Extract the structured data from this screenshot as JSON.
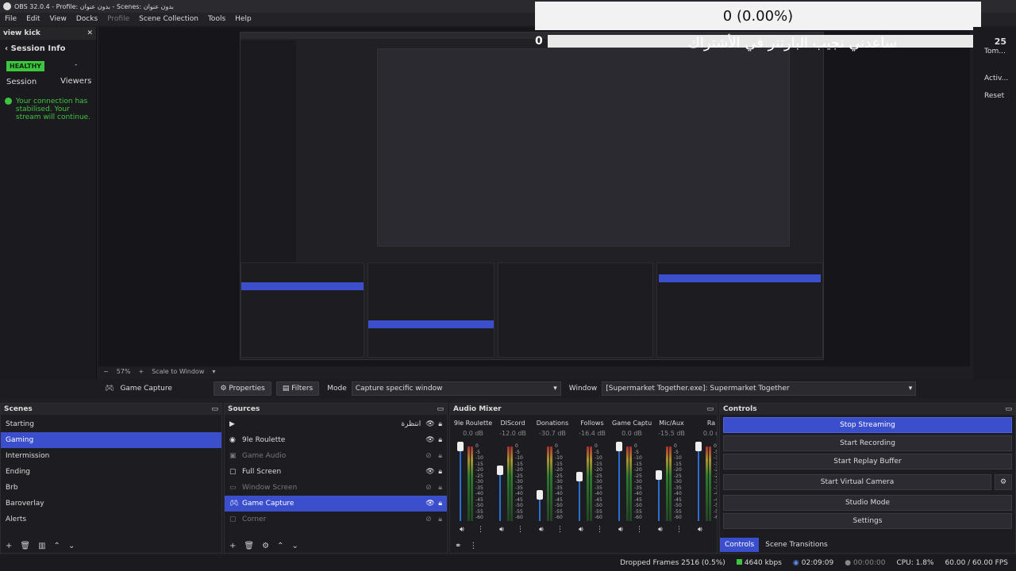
{
  "titlebar": {
    "title": "OBS 32.0.4 - Profile: بدون عنوان - Scenes: بدون عنوان"
  },
  "menu": [
    "File",
    "Edit",
    "View",
    "Docks",
    "Profile",
    "Scene Collection",
    "Tools",
    "Help"
  ],
  "left_dock": {
    "title": "view kick",
    "section": "Session Info",
    "health_badge": "HEALTHY",
    "health_sub": "Session",
    "viewers_value": "-",
    "viewers_label": "Viewers",
    "message": "Your connection has stabilised. Your stream will continue."
  },
  "overlay": {
    "percent_text": "0  (0.00%)",
    "zero": "0",
    "arabic_text": "ساعدني نجيب البارتنر في الأشتراك"
  },
  "right_dock": {
    "count": "25",
    "label1": "Tom...",
    "label2": "Activ...",
    "label3": "Reset"
  },
  "preview_bar": {
    "zoom": "57%",
    "scale_mode": "Scale to Window"
  },
  "toolbar": {
    "source_name": "Game Capture",
    "properties_label": "Properties",
    "filters_label": "Filters",
    "mode_label": "Mode",
    "mode_value": "Capture specific window",
    "window_label": "Window",
    "window_value": "[Supermarket Together.exe]: Supermarket Together"
  },
  "scenes": {
    "title": "Scenes",
    "items": [
      "Starting",
      "Gaming",
      "Intermission",
      "Ending",
      "Brb",
      "Baroverlay",
      "Alerts"
    ],
    "selected": "Gaming"
  },
  "sources": {
    "title": "Sources",
    "items": [
      {
        "name": "انتظرة",
        "icon": "play-icon",
        "dim": false
      },
      {
        "name": "9le Roulette",
        "icon": "browser-icon",
        "dim": false
      },
      {
        "name": "Game Audio",
        "icon": "audio-icon",
        "dim": true
      },
      {
        "name": "Full Screen",
        "icon": "image-icon",
        "dim": false
      },
      {
        "name": "Window Screen",
        "icon": "window-icon",
        "dim": true
      },
      {
        "name": "Game Capture",
        "icon": "gamepad-icon",
        "dim": false
      },
      {
        "name": "Corner",
        "icon": "image-icon",
        "dim": true
      }
    ],
    "selected": "Game Capture"
  },
  "audio_mixer": {
    "title": "Audio Mixer",
    "channels": [
      {
        "name": "9le Roulette",
        "db": "0.0 dB",
        "level": 1.0
      },
      {
        "name": "DIScord",
        "db": "-12.0 dB",
        "level": 0.68
      },
      {
        "name": "Donations",
        "db": "-30.7 dB",
        "level": 0.35
      },
      {
        "name": "Follows",
        "db": "-16.4 dB",
        "level": 0.6
      },
      {
        "name": "Game Capture",
        "db": "0.0 dB",
        "level": 1.0
      },
      {
        "name": "Mic/Aux",
        "db": "-15.5 dB",
        "level": 0.62
      },
      {
        "name": "Ra",
        "db": "0.0 d",
        "level": 1.0
      }
    ],
    "scale": [
      "0",
      "-5",
      "-10",
      "-15",
      "-20",
      "-25",
      "-30",
      "-35",
      "-40",
      "-45",
      "-50",
      "-55",
      "-60"
    ]
  },
  "controls": {
    "title": "Controls",
    "buttons": [
      "Stop Streaming",
      "Start Recording",
      "Start Replay Buffer",
      "Start Virtual Camera",
      "Studio Mode",
      "Settings"
    ],
    "tabs": [
      "Controls",
      "Scene Transitions"
    ]
  },
  "status": {
    "dropped": "Dropped Frames 2516 (0.5%)",
    "bitrate": "4640 kbps",
    "live_time": "02:09:09",
    "rec_time": "00:00:00",
    "cpu": "CPU: 1.8%",
    "fps": "60.00 / 60.00 FPS"
  },
  "colors": {
    "accent": "#3b4ecc",
    "healthy": "#3ec43e"
  }
}
